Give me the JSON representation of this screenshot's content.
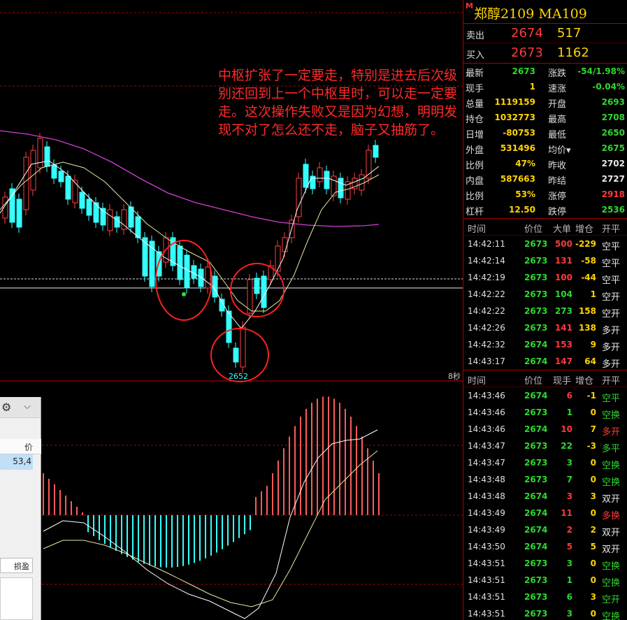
{
  "header": {
    "market_flag": "M",
    "title": "郑醇2109  MA109"
  },
  "orderbook": {
    "ask_label": "卖出",
    "ask_price": "2674",
    "ask_vol": "517",
    "bid_label": "买入",
    "bid_price": "2673",
    "bid_vol": "1162"
  },
  "stats_left": [
    {
      "k": "最新",
      "v": "2673",
      "c": "dn"
    },
    {
      "k": "现手",
      "v": "1",
      "c": "ye"
    },
    {
      "k": "总量",
      "v": "1119159",
      "c": "ye"
    },
    {
      "k": "持仓",
      "v": "1032773",
      "c": "ye"
    },
    {
      "k": "日增",
      "v": "-80753",
      "c": "ye"
    },
    {
      "k": "外盘",
      "v": "531496",
      "c": "ye"
    },
    {
      "k": "比例",
      "v": "47%",
      "c": "ye"
    },
    {
      "k": "内盘",
      "v": "587663",
      "c": "ye"
    },
    {
      "k": "比例",
      "v": "53%",
      "c": "ye"
    },
    {
      "k": "杠杆",
      "v": "12.50",
      "c": "ye"
    }
  ],
  "stats_right": [
    {
      "k": "涨跌",
      "v": "-54/1.98%",
      "c": "dn"
    },
    {
      "k": "速涨",
      "v": "-0.04%",
      "c": "dn"
    },
    {
      "k": "开盘",
      "v": "2693",
      "c": "dn"
    },
    {
      "k": "最高",
      "v": "2708",
      "c": "dn"
    },
    {
      "k": "最低",
      "v": "2650",
      "c": "dn"
    },
    {
      "k": "均价▾",
      "v": "2675",
      "c": "dn"
    },
    {
      "k": "昨收",
      "v": "2702",
      "c": "wh"
    },
    {
      "k": "昨结",
      "v": "2727",
      "c": "wh"
    },
    {
      "k": "涨停",
      "v": "2918",
      "c": "up"
    },
    {
      "k": "跌停",
      "v": "2536",
      "c": "dn"
    }
  ],
  "big_trades": {
    "headers": [
      "时间",
      "价位",
      "大单",
      "增仓",
      "开平"
    ],
    "rows": [
      {
        "t": "14:42:11",
        "p": "2673",
        "pc": "dn",
        "v": "500",
        "vc": "up",
        "o": "-229",
        "oc": "ye",
        "type": "空平",
        "tc": "wh"
      },
      {
        "t": "14:42:14",
        "p": "2673",
        "pc": "dn",
        "v": "131",
        "vc": "up",
        "o": "-58",
        "oc": "ye",
        "type": "空平",
        "tc": "wh"
      },
      {
        "t": "14:42:19",
        "p": "2673",
        "pc": "dn",
        "v": "100",
        "vc": "up",
        "o": "-44",
        "oc": "ye",
        "type": "空平",
        "tc": "wh"
      },
      {
        "t": "14:42:22",
        "p": "2673",
        "pc": "dn",
        "v": "104",
        "vc": "dn",
        "o": "1",
        "oc": "ye",
        "type": "空开",
        "tc": "wh"
      },
      {
        "t": "14:42:22",
        "p": "2673",
        "pc": "dn",
        "v": "273",
        "vc": "dn",
        "o": "158",
        "oc": "ye",
        "type": "空开",
        "tc": "wh"
      },
      {
        "t": "14:42:26",
        "p": "2673",
        "pc": "dn",
        "v": "141",
        "vc": "up",
        "o": "138",
        "oc": "ye",
        "type": "多开",
        "tc": "wh"
      },
      {
        "t": "14:42:32",
        "p": "2674",
        "pc": "dn",
        "v": "153",
        "vc": "up",
        "o": "9",
        "oc": "ye",
        "type": "多开",
        "tc": "wh"
      },
      {
        "t": "14:43:17",
        "p": "2674",
        "pc": "dn",
        "v": "147",
        "vc": "up",
        "o": "64",
        "oc": "ye",
        "type": "多开",
        "tc": "wh"
      }
    ]
  },
  "ticks": {
    "headers": [
      "时间",
      "价位",
      "现手",
      "增仓",
      "开平"
    ],
    "rows": [
      {
        "t": "14:43:46",
        "p": "2674",
        "v": "6",
        "vc": "up",
        "o": "-1",
        "type": "空平",
        "tc": "dn"
      },
      {
        "t": "14:43:46",
        "p": "2673",
        "v": "1",
        "vc": "dn",
        "o": "0",
        "type": "空换",
        "tc": "dn"
      },
      {
        "t": "14:43:46",
        "p": "2674",
        "v": "10",
        "vc": "up",
        "o": "7",
        "type": "多开",
        "tc": "up"
      },
      {
        "t": "14:43:47",
        "p": "2673",
        "v": "22",
        "vc": "dn",
        "o": "-3",
        "type": "多平",
        "tc": "dn"
      },
      {
        "t": "14:43:47",
        "p": "2673",
        "v": "3",
        "vc": "dn",
        "o": "0",
        "type": "空换",
        "tc": "dn"
      },
      {
        "t": "14:43:48",
        "p": "2673",
        "v": "7",
        "vc": "dn",
        "o": "0",
        "type": "空换",
        "tc": "dn"
      },
      {
        "t": "14:43:48",
        "p": "2674",
        "v": "3",
        "vc": "up",
        "o": "3",
        "type": "双开",
        "tc": "wh"
      },
      {
        "t": "14:43:49",
        "p": "2674",
        "v": "11",
        "vc": "up",
        "o": "0",
        "type": "多换",
        "tc": "up"
      },
      {
        "t": "14:43:49",
        "p": "2674",
        "v": "2",
        "vc": "up",
        "o": "2",
        "type": "双开",
        "tc": "wh"
      },
      {
        "t": "14:43:50",
        "p": "2674",
        "v": "5",
        "vc": "up",
        "o": "5",
        "type": "双开",
        "tc": "wh"
      },
      {
        "t": "14:43:51",
        "p": "2673",
        "v": "3",
        "vc": "dn",
        "o": "0",
        "type": "空换",
        "tc": "dn"
      },
      {
        "t": "14:43:51",
        "p": "2673",
        "v": "1",
        "vc": "dn",
        "o": "0",
        "type": "空换",
        "tc": "dn"
      },
      {
        "t": "14:43:51",
        "p": "2673",
        "v": "6",
        "vc": "dn",
        "o": "3",
        "type": "空开",
        "tc": "dn"
      },
      {
        "t": "14:43:51",
        "p": "2673",
        "v": "3",
        "vc": "dn",
        "o": "0",
        "type": "空换",
        "tc": "dn"
      }
    ]
  },
  "chart": {
    "annotation": "中枢扩张了一定要走，特别是进去后次级别还回到上一个中枢里时，可以走一定要走。这次操作失败又是因为幻想，明明发现不对了怎么还不走，脑子又抽筋了。",
    "low_label": "2652",
    "countdown": "8秒"
  },
  "order_panel": {
    "price_header": "价",
    "row_value": "53,4",
    "tab_label": "损盈"
  }
}
